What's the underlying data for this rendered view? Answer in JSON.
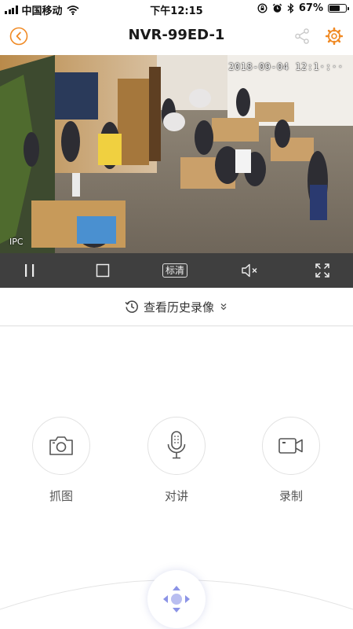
{
  "status_bar": {
    "carrier": "中国移动",
    "time": "下午12:15",
    "battery_percent": "67%",
    "battery_level": 0.67
  },
  "nav": {
    "title": "NVR-99ED-1",
    "back_icon": "back-chevron-icon",
    "share_icon": "share-icon",
    "settings_icon": "gear-icon",
    "accent_color": "#F08A24"
  },
  "video": {
    "timestamp": "2018-09-04 12:1·:··",
    "channel_label": "IPC"
  },
  "controls": {
    "pause_icon": "pause-icon",
    "stop_icon": "stop-icon",
    "quality_label": "标清",
    "mute_icon": "mute-icon",
    "fullscreen_icon": "fullscreen-icon"
  },
  "history": {
    "label": "查看历史录像",
    "icon": "clock-history-icon",
    "expand_icon": "double-chevron-down-icon"
  },
  "actions": [
    {
      "label": "抓图",
      "icon": "camera-icon"
    },
    {
      "label": "对讲",
      "icon": "microphone-icon"
    },
    {
      "label": "录制",
      "icon": "video-camera-icon"
    }
  ],
  "ptz": {
    "icon": "ptz-direction-icon",
    "color": "#8B93E6"
  }
}
